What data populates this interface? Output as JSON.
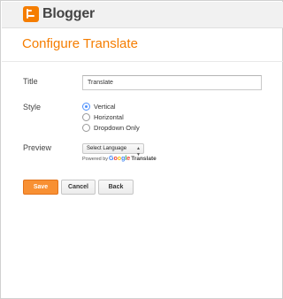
{
  "header": {
    "brand": "Blogger",
    "logo_icon": "blogger-logo-icon",
    "brand_color": "#f57d00"
  },
  "page": {
    "title": "Configure Translate"
  },
  "form": {
    "title_label": "Title",
    "title_value": "Translate",
    "style_label": "Style",
    "style_options": [
      {
        "label": "Vertical",
        "checked": true
      },
      {
        "label": "Horizontal",
        "checked": false
      },
      {
        "label": "Dropdown Only",
        "checked": false
      }
    ],
    "preview_label": "Preview",
    "preview_select": "Select Language",
    "powered_by": "Powered by",
    "google_letters": [
      "G",
      "o",
      "o",
      "g",
      "l",
      "e"
    ],
    "google_colors": [
      "#4285f4",
      "#ea4335",
      "#fbbc05",
      "#4285f4",
      "#34a853",
      "#ea4335"
    ],
    "translate_word": "Translate"
  },
  "buttons": {
    "save": "Save",
    "cancel": "Cancel",
    "back": "Back"
  },
  "colors": {
    "accent": "#f57d00",
    "save_button": "#f89033",
    "radio_selected": "#4d90fe"
  }
}
